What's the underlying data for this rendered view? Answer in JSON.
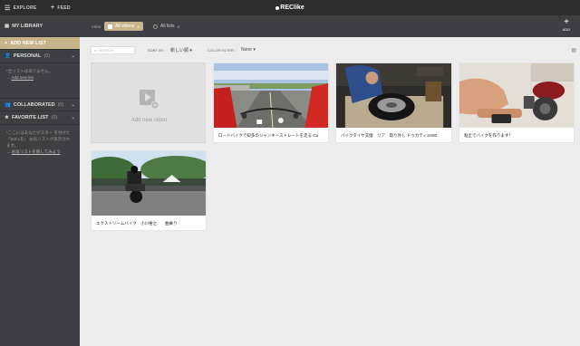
{
  "topbar": {
    "menu_icon": "grid-menu-icon",
    "explore_label": "EXPLORE",
    "feed_label": "FEED",
    "logo": "REClike"
  },
  "sidebar": {
    "my_library": "MY LIBRARY",
    "add_new_list": "ADD NEW LIST",
    "personal": {
      "label": "PERSONAL",
      "count": "(0)",
      "empty_text": "*全リストはありません。",
      "empty_link": "Add new list"
    },
    "collaborated": {
      "label": "COLLABORATED",
      "count": "(0)"
    },
    "favorite": {
      "label": "FAVORITE LIST",
      "count": "(0)",
      "empty_text": "*ここにはあなたがスター を付けた「Sof Lを」 お気リストが表示されます。",
      "empty_link": "お気リストを探してみよう"
    }
  },
  "subbar": {
    "view_label": "VIEW:",
    "all_videos": {
      "label": "All videos",
      "count": "4"
    },
    "all_lists": {
      "label": "All lists",
      "count": "0"
    },
    "add_label": "ADD"
  },
  "toolbar": {
    "search_placeholder": "SEARCH",
    "sort_label": "SORT BY :",
    "sort_value": "新しい順 ▾",
    "color_label": "COLOR FILTER :",
    "color_value": "None ▾"
  },
  "add_card_label": "Add new video",
  "videos": [
    {
      "title": "ロードバイクで知多のジャンキーストレートを走る Go"
    },
    {
      "title": "バイクタイヤ交換　リア　取り外し ドゥカティSS90"
    },
    {
      "title": "粘土でバイクを作ります！"
    },
    {
      "title": "エクストリームバイク　小川裕之　　曲乗り"
    }
  ],
  "colors": {
    "topbar": "#2b2d2f",
    "sidebar": "#3c3f43",
    "accent": "#c8b48b",
    "content_bg": "#ececec"
  }
}
